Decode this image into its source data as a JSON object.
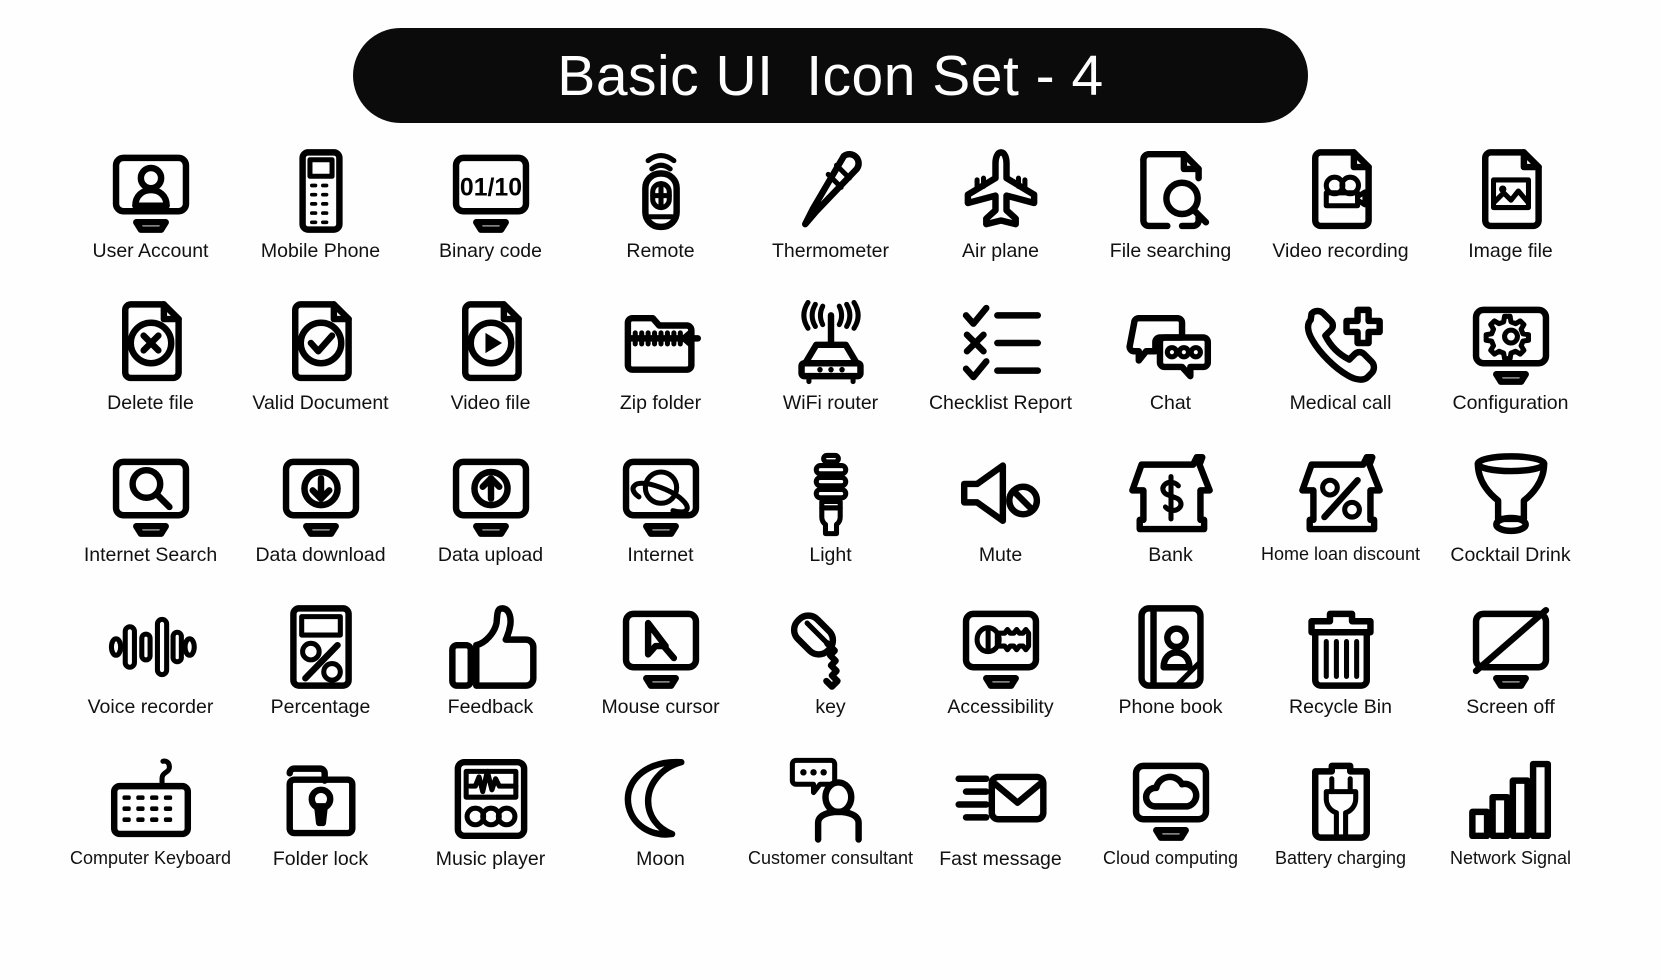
{
  "header": {
    "title": "Basic UI  Icon Set - 4"
  },
  "icons": [
    {
      "label": "User Account",
      "name": "user-account-icon"
    },
    {
      "label": "Mobile Phone",
      "name": "mobile-phone-icon"
    },
    {
      "label": "Binary code",
      "name": "binary-code-icon",
      "glyph": "01/10"
    },
    {
      "label": "Remote",
      "name": "remote-icon"
    },
    {
      "label": "Thermometer",
      "name": "thermometer-icon"
    },
    {
      "label": "Air plane",
      "name": "air-plane-icon"
    },
    {
      "label": "File searching",
      "name": "file-searching-icon"
    },
    {
      "label": "Video recording",
      "name": "video-recording-icon"
    },
    {
      "label": "Image file",
      "name": "image-file-icon"
    },
    {
      "label": "Delete file",
      "name": "delete-file-icon"
    },
    {
      "label": "Valid Document",
      "name": "valid-document-icon"
    },
    {
      "label": "Video file",
      "name": "video-file-icon"
    },
    {
      "label": "Zip folder",
      "name": "zip-folder-icon"
    },
    {
      "label": "WiFi router",
      "name": "wifi-router-icon"
    },
    {
      "label": "Checklist Report",
      "name": "checklist-report-icon"
    },
    {
      "label": "Chat",
      "name": "chat-icon"
    },
    {
      "label": "Medical call",
      "name": "medical-call-icon"
    },
    {
      "label": "Configuration",
      "name": "configuration-icon"
    },
    {
      "label": "Internet Search",
      "name": "internet-search-icon"
    },
    {
      "label": "Data download",
      "name": "data-download-icon"
    },
    {
      "label": "Data upload",
      "name": "data-upload-icon"
    },
    {
      "label": "Internet",
      "name": "internet-icon"
    },
    {
      "label": "Light",
      "name": "light-icon"
    },
    {
      "label": "Mute",
      "name": "mute-icon"
    },
    {
      "label": "Bank",
      "name": "bank-icon"
    },
    {
      "label": "Home loan discount",
      "name": "home-loan-discount-icon"
    },
    {
      "label": "Cocktail Drink",
      "name": "cocktail-drink-icon"
    },
    {
      "label": "Voice recorder",
      "name": "voice-recorder-icon"
    },
    {
      "label": "Percentage",
      "name": "percentage-icon"
    },
    {
      "label": "Feedback",
      "name": "feedback-icon"
    },
    {
      "label": "Mouse cursor",
      "name": "mouse-cursor-icon"
    },
    {
      "label": "key",
      "name": "key-icon"
    },
    {
      "label": "Accessibility",
      "name": "accessibility-icon"
    },
    {
      "label": "Phone book",
      "name": "phone-book-icon"
    },
    {
      "label": "Recycle Bin",
      "name": "recycle-bin-icon"
    },
    {
      "label": "Screen off",
      "name": "screen-off-icon"
    },
    {
      "label": "Computer Keyboard",
      "name": "computer-keyboard-icon"
    },
    {
      "label": "Folder lock",
      "name": "folder-lock-icon"
    },
    {
      "label": "Music player",
      "name": "music-player-icon"
    },
    {
      "label": "Moon",
      "name": "moon-icon"
    },
    {
      "label": "Customer consultant",
      "name": "customer-consultant-icon"
    },
    {
      "label": "Fast message",
      "name": "fast-message-icon"
    },
    {
      "label": "Cloud computing",
      "name": "cloud-computing-icon"
    },
    {
      "label": "Battery charging",
      "name": "battery-charging-icon"
    },
    {
      "label": "Network Signal",
      "name": "network-signal-icon"
    }
  ],
  "style": {
    "stroke_color": "#000000",
    "background_color": "#ffffff",
    "title_background": "#0b0b0b",
    "title_color": "#ffffff"
  }
}
